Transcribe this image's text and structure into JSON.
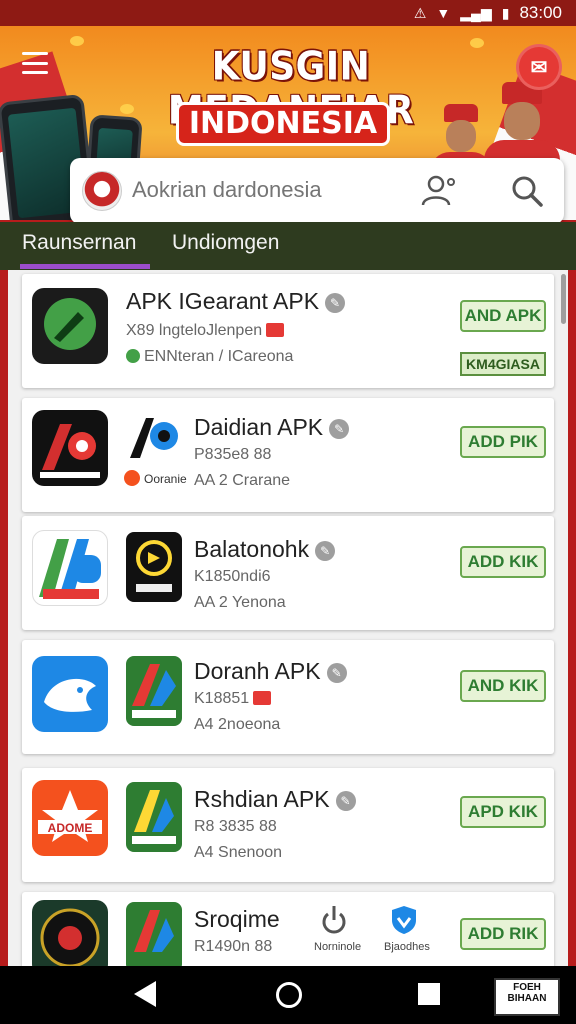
{
  "status_bar": {
    "time": "83:00"
  },
  "banner": {
    "title": "KUSGIN MEDANEIAR",
    "subtitle": "INDONESIA"
  },
  "search": {
    "placeholder": "Aokrian dardonesia"
  },
  "tabs": [
    {
      "label": "Raunsernan",
      "selected": true
    },
    {
      "label": "Undiomgen",
      "selected": false
    }
  ],
  "apps": [
    {
      "name": "APK IGearant APK",
      "meta1": "X89 lngteloJlenpen",
      "meta2": "ENNteran / ICareona",
      "button": "AND APK",
      "badge": "KM4GIASA"
    },
    {
      "name": "Daidian APK",
      "meta1": "P835e8 88",
      "meta2": "AA 2 Crarane",
      "icon2_label": "Ooranie",
      "button": "ADD PIK"
    },
    {
      "name": "Balatonohk",
      "meta1": "K1850ndi6",
      "meta2": "AA 2 Yenona",
      "button": "ADD KIK"
    },
    {
      "name": "Doranh APK",
      "meta1": "K18851",
      "meta2": "A4 2noeona",
      "button": "AND KIK"
    },
    {
      "name": "Rshdian APK",
      "meta1": "R8 3835 88",
      "meta2": "A4 Snenoon",
      "button": "APD KIK"
    },
    {
      "name": "Sroqime",
      "meta1": "R1490n 88",
      "meta2": "",
      "mini_icons": [
        "Norninole",
        "Bjaodhes"
      ],
      "button": "ADD RIK"
    }
  ],
  "watermark": [
    "FOEH",
    "BIHAAN"
  ],
  "colors": {
    "accent_red": "#d32f2f",
    "tab_bar": "#2e3b1f",
    "button_green": "#6aa84f",
    "tab_underline": "#9c4dcc"
  },
  "icons": [
    "wifi-icon",
    "signal-icon",
    "battery-icon",
    "menu-icon",
    "promo-icon",
    "user-settings-icon",
    "search-icon",
    "verified-icon",
    "back-icon",
    "home-icon",
    "recent-apps-icon"
  ]
}
